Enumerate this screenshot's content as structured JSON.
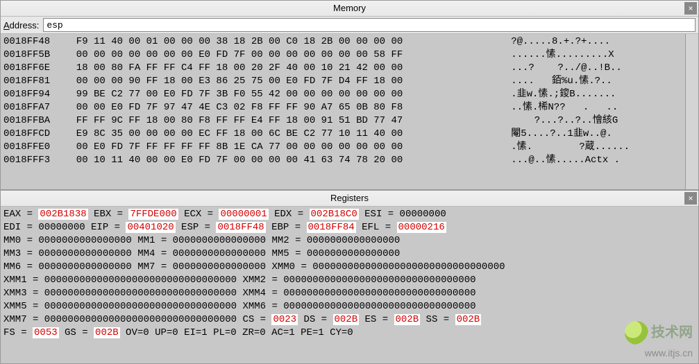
{
  "memory_panel": {
    "title": "Memory",
    "address_label_pre": "A",
    "address_label_post": "ddress:",
    "address_value": "esp",
    "rows": [
      {
        "addr": "0018FF48",
        "bytes": "F9 11 40 00 01 00 00 00 38 18 2B 00 C0 18 2B 00 00 00 00",
        "ascii": "?@.....8.+.?+...."
      },
      {
        "addr": "0018FF5B",
        "bytes": "00 00 00 00 00 00 00 E0 FD 7F 00 00 00 00 00 00 00 58 FF",
        "ascii": "......愫.........X"
      },
      {
        "addr": "0018FF6E",
        "bytes": "18 00 80 FA FF FF C4 FF 18 00 20 2F 40 00 10 21 42 00 00",
        "ascii": "...?    ?../@..!B.."
      },
      {
        "addr": "0018FF81",
        "bytes": "00 00 00 90 FF 18 00 E3 86 25 75 00 E0 FD 7F D4 FF 18 00",
        "ascii": "....   銆%u.愫.?.."
      },
      {
        "addr": "0018FF94",
        "bytes": "99 BE C2 77 00 E0 FD 7F 3B F0 55 42 00 00 00 00 00 00 00",
        "ascii": ".韭w.愫.;鎫B......."
      },
      {
        "addr": "0018FFA7",
        "bytes": "00 00 E0 FD 7F 97 47 4E C3 02 F8 FF FF 90 A7 65 0B 80 F8",
        "ascii": "..愫.桸N??   .   .."
      },
      {
        "addr": "0018FFBA",
        "bytes": "FF FF 9C FF 18 00 80 F8 FF FF E4 FF 18 00 91 51 BD 77 47",
        "ascii": "    ?...?..?..懀絯G"
      },
      {
        "addr": "0018FFCD",
        "bytes": "E9 8C 35 00 00 00 00 EC FF 18 00 6C BE C2 77 10 11 40 00",
        "ascii": "閹5....?..1韭w..@."
      },
      {
        "addr": "0018FFE0",
        "bytes": "00 E0 FD 7F FF FF FF FF 8B 1E CA 77 00 00 00 00 00 00 00",
        "ascii": ".愫.        ?蔵......"
      },
      {
        "addr": "0018FFF3",
        "bytes": "00 10 11 40 00 00 E0 FD 7F 00 00 00 00 41 63 74 78 20 00",
        "ascii": "...@..愫.....Actx ."
      }
    ]
  },
  "registers_panel": {
    "title": "Registers",
    "regs": {
      "EAX": "002B1838",
      "EBX": "7FFDE000",
      "ECX": "00000001",
      "EDX": "002B18C0",
      "ESI": "00000000",
      "EDI": "00000000",
      "EIP": "00401020",
      "ESP": "0018FF48",
      "EBP": "0018FF84",
      "EFL": "00000216",
      "MM0": "0000000000000000",
      "MM1": "0000000000000000",
      "MM2": "0000000000000000",
      "MM3": "0000000000000000",
      "MM4": "0000000000000000",
      "MM5": "0000000000000000",
      "MM6": "0000000000000000",
      "MM7": "0000000000000000",
      "XMM0": "000000000000000000000000000000000",
      "XMM1": "000000000000000000000000000000000",
      "XMM2": "000000000000000000000000000000000",
      "XMM3": "000000000000000000000000000000000",
      "XMM4": "000000000000000000000000000000000",
      "XMM5": "000000000000000000000000000000000",
      "XMM6": "000000000000000000000000000000000",
      "XMM7": "000000000000000000000000000000000",
      "CS": "0023",
      "DS": "002B",
      "ES": "002B",
      "SS": "002B",
      "FS": "0053",
      "GS": "002B"
    },
    "flags": {
      "OV": "0",
      "UP": "0",
      "EI": "1",
      "PL": "0",
      "ZR": "0",
      "AC": "1",
      "PE": "1",
      "CY": "0"
    }
  },
  "watermark": {
    "text_main": "技术网",
    "text_sub": "www.itjs.cn"
  }
}
